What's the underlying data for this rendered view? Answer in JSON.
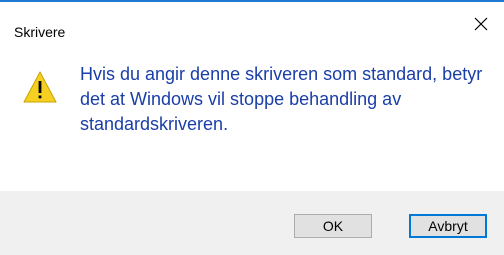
{
  "window": {
    "title": "Skrivere",
    "close_icon": "close-icon"
  },
  "dialog": {
    "icon": "warning-icon",
    "message": "Hvis du angir denne skriveren som standard, betyr det at Windows vil stoppe behandling av standardskriveren."
  },
  "buttons": {
    "ok_label": "OK",
    "cancel_label": "Avbryt"
  },
  "colors": {
    "message_text": "#1a3ea8",
    "warning_fill": "#f5d020",
    "default_button_border": "#0078d7"
  }
}
